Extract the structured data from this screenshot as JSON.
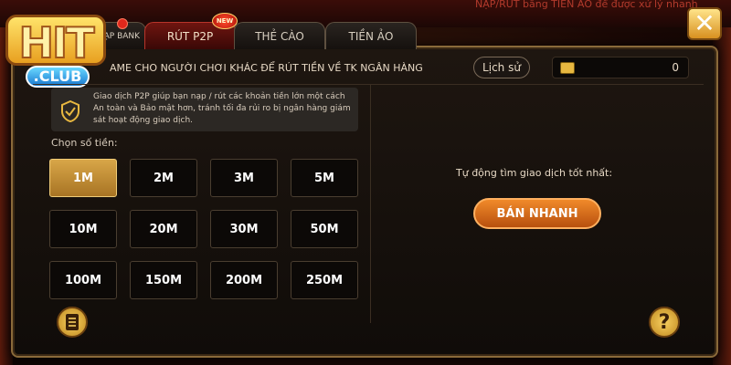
{
  "background": {
    "top_text": "NẠP/RÚT bằng TIỀN ẢO để được xử lý nhanh"
  },
  "logo": {
    "hit": "HIT",
    "club": ".CLUB"
  },
  "tabs": [
    {
      "label": "NẠP BANK",
      "active": false
    },
    {
      "label": "RÚT P2P",
      "active": true,
      "badge": "NEW"
    },
    {
      "label": "THẺ CÀO",
      "active": false
    },
    {
      "label": "TIỀN ẢO",
      "active": false
    }
  ],
  "header": {
    "text": "AME CHO NGƯỜI CHƠI KHÁC ĐỂ RÚT TIỀN VỀ TK NGÂN HÀNG",
    "history_label": "Lịch sử",
    "balance": "0"
  },
  "note": {
    "text": "Giao dịch P2P giúp bạn nạp / rút các khoản tiền lớn một cách An toàn và Bảo mật hơn, tránh tối đa rủi ro bị ngân hàng giám sát hoạt động giao dịch."
  },
  "amount": {
    "label": "Chọn số tiền:",
    "selected": "1M",
    "options": [
      "1M",
      "2M",
      "3M",
      "5M",
      "10M",
      "20M",
      "30M",
      "50M",
      "100M",
      "150M",
      "200M",
      "250M"
    ]
  },
  "right": {
    "auto_text": "Tự động tìm giao dịch tốt nhất:",
    "sell_label": "BÁN NHANH"
  },
  "help_glyph": "?",
  "close_glyph": "✕",
  "colors": {
    "accent_gold": "#d8a648",
    "sell_orange": "#f08a2a",
    "active_tab_red": "#6e1510"
  }
}
